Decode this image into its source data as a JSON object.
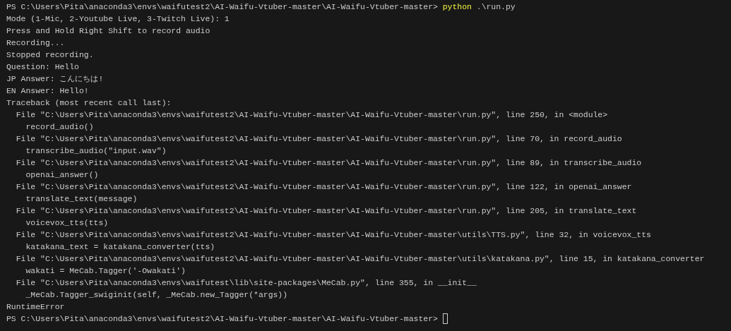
{
  "terminal": {
    "lines": [
      {
        "kind": "prompt",
        "prompt": "PS C:\\Users\\Pita\\anaconda3\\envs\\waifutest2\\AI-Waifu-Vtuber-master\\AI-Waifu-Vtuber-master>",
        "command": "python",
        "args": ".\\run.py"
      },
      {
        "kind": "output",
        "text": "Mode (1-Mic, 2-Youtube Live, 3-Twitch Live): 1"
      },
      {
        "kind": "output",
        "text": "Press and Hold Right Shift to record audio"
      },
      {
        "kind": "output",
        "text": "Recording..."
      },
      {
        "kind": "output",
        "text": "Stopped recording."
      },
      {
        "kind": "output",
        "text": "Question: Hello"
      },
      {
        "kind": "output",
        "text": "JP Answer: こんにちは!"
      },
      {
        "kind": "output",
        "text": "EN Answer: Hello!"
      },
      {
        "kind": "output",
        "text": "Traceback (most recent call last):"
      },
      {
        "kind": "output",
        "text": "  File \"C:\\Users\\Pita\\anaconda3\\envs\\waifutest2\\AI-Waifu-Vtuber-master\\AI-Waifu-Vtuber-master\\run.py\", line 250, in <module>"
      },
      {
        "kind": "output",
        "text": "    record_audio()"
      },
      {
        "kind": "output",
        "text": "  File \"C:\\Users\\Pita\\anaconda3\\envs\\waifutest2\\AI-Waifu-Vtuber-master\\AI-Waifu-Vtuber-master\\run.py\", line 70, in record_audio"
      },
      {
        "kind": "output",
        "text": "    transcribe_audio(\"input.wav\")"
      },
      {
        "kind": "output",
        "text": "  File \"C:\\Users\\Pita\\anaconda3\\envs\\waifutest2\\AI-Waifu-Vtuber-master\\AI-Waifu-Vtuber-master\\run.py\", line 89, in transcribe_audio"
      },
      {
        "kind": "output",
        "text": "    openai_answer()"
      },
      {
        "kind": "output",
        "text": "  File \"C:\\Users\\Pita\\anaconda3\\envs\\waifutest2\\AI-Waifu-Vtuber-master\\AI-Waifu-Vtuber-master\\run.py\", line 122, in openai_answer"
      },
      {
        "kind": "output",
        "text": "    translate_text(message)"
      },
      {
        "kind": "output",
        "text": "  File \"C:\\Users\\Pita\\anaconda3\\envs\\waifutest2\\AI-Waifu-Vtuber-master\\AI-Waifu-Vtuber-master\\run.py\", line 205, in translate_text"
      },
      {
        "kind": "output",
        "text": "    voicevox_tts(tts)"
      },
      {
        "kind": "output",
        "text": "  File \"C:\\Users\\Pita\\anaconda3\\envs\\waifutest2\\AI-Waifu-Vtuber-master\\AI-Waifu-Vtuber-master\\utils\\TTS.py\", line 32, in voicevox_tts"
      },
      {
        "kind": "output",
        "text": "    katakana_text = katakana_converter(tts)"
      },
      {
        "kind": "output",
        "text": "  File \"C:\\Users\\Pita\\anaconda3\\envs\\waifutest2\\AI-Waifu-Vtuber-master\\AI-Waifu-Vtuber-master\\utils\\katakana.py\", line 15, in katakana_converter"
      },
      {
        "kind": "output",
        "text": "    wakati = MeCab.Tagger('-Owakati')"
      },
      {
        "kind": "output",
        "text": "  File \"C:\\Users\\Pita\\anaconda3\\envs\\waifutest\\lib\\site-packages\\MeCab.py\", line 355, in __init__"
      },
      {
        "kind": "output",
        "text": "    _MeCab.Tagger_swiginit(self, _MeCab.new_Tagger(*args))"
      },
      {
        "kind": "output",
        "text": "RuntimeError"
      },
      {
        "kind": "prompt",
        "prompt": "PS C:\\Users\\Pita\\anaconda3\\envs\\waifutest2\\AI-Waifu-Vtuber-master\\AI-Waifu-Vtuber-master>",
        "cursor": true
      }
    ]
  }
}
